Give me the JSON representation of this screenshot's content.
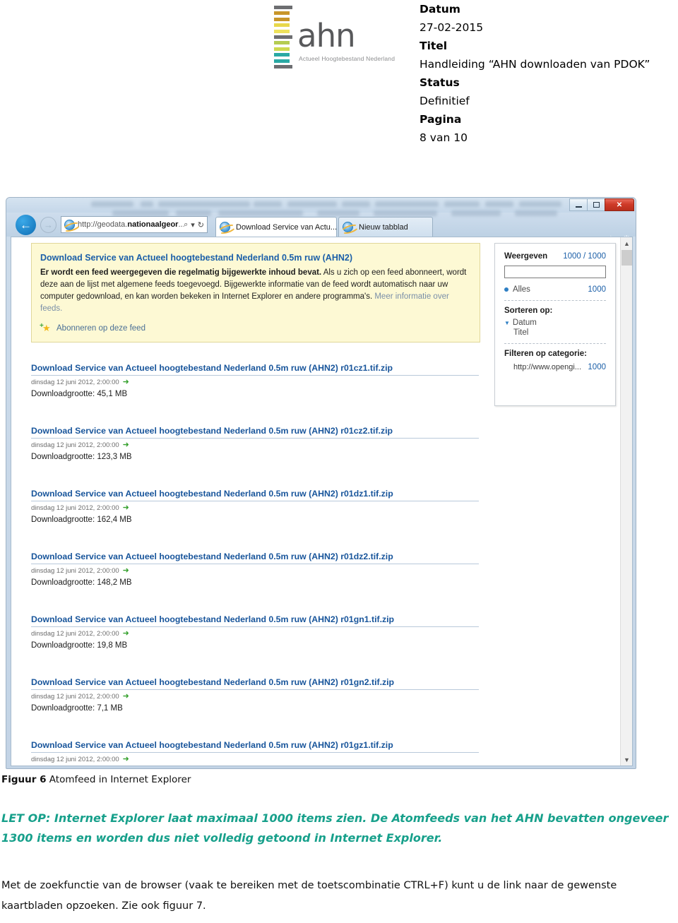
{
  "document_header": {
    "logo": {
      "wordmark": "ahn",
      "tagline": "Actueel Hoogtebestand Nederland",
      "bar_colors": [
        "#6d6e71",
        "#c8962a",
        "#c8962a",
        "#e8d84a",
        "#eee25c",
        "#6d6e71",
        "#b5cc52",
        "#cdd94f",
        "#2aa9a4",
        "#2aa9a4",
        "#6d6e71"
      ]
    },
    "fields": [
      {
        "label": "Datum",
        "value": "27-02-2015"
      },
      {
        "label": "Titel",
        "value": "Handleiding “AHN downloaden van PDOK”"
      },
      {
        "label": "Status",
        "value": "Definitief"
      },
      {
        "label": "Pagina",
        "value": "8 van 10"
      }
    ]
  },
  "browser": {
    "window_controls": {
      "minimize": "minimize",
      "maximize": "maximize",
      "close": "✕"
    },
    "back_label": "←",
    "forward_label": "→",
    "address": {
      "prefix": "http://geodata.",
      "bold": "nationaalgeor",
      "suffix": "...",
      "search_icon": "⌕",
      "refresh_icon": "↻"
    },
    "tabs": [
      {
        "label": "Download Service van Actu...",
        "active": true,
        "close": "✕"
      },
      {
        "label": "Nieuw tabblad",
        "active": false
      }
    ],
    "toolbar_icons": [
      "home-icon",
      "favorites-icon",
      "settings-icon"
    ],
    "toolbar_glyphs": {
      "home": "⌂",
      "favorites": "☆",
      "settings": "⚙"
    }
  },
  "feed_info": {
    "title": "Download Service van Actueel hoogtebestand Nederland 0.5m ruw (AHN2)",
    "bold_lead": "Er wordt een feed weergegeven die regelmatig bijgewerkte inhoud bevat.",
    "body": " Als u zich op een feed abonneert, wordt deze aan de lijst met algemene feeds toegevoegd. Bijgewerkte informatie van de feed wordt automatisch naar uw computer gedownload, en kan worden bekeken in Internet Explorer en andere programma's. ",
    "link_text": "Meer informatie over feeds.",
    "subscribe_label": "Abonneren op deze feed"
  },
  "filter_panel": {
    "weergeven_label": "Weergeven",
    "weergeven_count": "1000 / 1000",
    "search_value": "",
    "alles_label": "Alles",
    "alles_count": "1000",
    "sorteren_label": "Sorteren op:",
    "sort_options": [
      "Datum",
      "Titel"
    ],
    "filteren_label": "Filteren op categorie:",
    "category_url": "http://www.opengi...",
    "category_count": "1000"
  },
  "feed_entries": [
    {
      "title": "Download Service van Actueel hoogtebestand Nederland 0.5m ruw (AHN2) r01cz1.tif.zip",
      "date": "dinsdag 12 juni 2012, 2:00:00",
      "size": "Downloadgrootte: 45,1 MB"
    },
    {
      "title": "Download Service van Actueel hoogtebestand Nederland 0.5m ruw (AHN2) r01cz2.tif.zip",
      "date": "dinsdag 12 juni 2012, 2:00:00",
      "size": "Downloadgrootte: 123,3 MB"
    },
    {
      "title": "Download Service van Actueel hoogtebestand Nederland 0.5m ruw (AHN2) r01dz1.tif.zip",
      "date": "dinsdag 12 juni 2012, 2:00:00",
      "size": "Downloadgrootte: 162,4 MB"
    },
    {
      "title": "Download Service van Actueel hoogtebestand Nederland 0.5m ruw (AHN2) r01dz2.tif.zip",
      "date": "dinsdag 12 juni 2012, 2:00:00",
      "size": "Downloadgrootte: 148,2 MB"
    },
    {
      "title": "Download Service van Actueel hoogtebestand Nederland 0.5m ruw (AHN2) r01gn1.tif.zip",
      "date": "dinsdag 12 juni 2012, 2:00:00",
      "size": "Downloadgrootte: 19,8 MB"
    },
    {
      "title": "Download Service van Actueel hoogtebestand Nederland 0.5m ruw (AHN2) r01gn2.tif.zip",
      "date": "dinsdag 12 juni 2012, 2:00:00",
      "size": "Downloadgrootte: 7,1 MB"
    },
    {
      "title": "Download Service van Actueel hoogtebestand Nederland 0.5m ruw (AHN2) r01gz1.tif.zip",
      "date": "dinsdag 12 juni 2012, 2:00:00",
      "size": ""
    }
  ],
  "caption": {
    "bold": "Figuur 6",
    "rest": " Atomfeed in Internet Explorer"
  },
  "note": "LET OP: Internet Explorer laat maximaal 1000 items zien. De Atomfeeds van het AHN bevatten ongeveer 1300 items en worden dus niet volledig getoond in Internet Explorer.",
  "paragraph": "Met de zoekfunctie van de browser (vaak te bereiken met de toetscombinatie CTRL+F) kunt u de link naar de gewenste kaartbladen opzoeken. Zie ook figuur 7.",
  "colors": {
    "note_teal": "#17a08b",
    "link_blue": "#18559b",
    "feedbox_yellow": "#fdf9d4",
    "ie_blue": "#1b7fc4"
  }
}
